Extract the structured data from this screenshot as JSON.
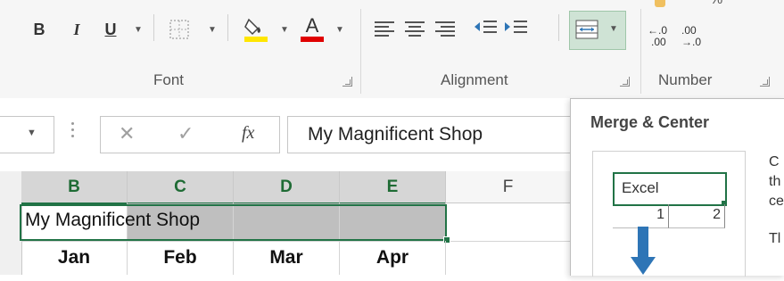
{
  "ribbon": {
    "font_group": {
      "bold": "B",
      "italic": "I",
      "underline": "U",
      "font_color_glyph": "A",
      "label": "Font"
    },
    "alignment_group": {
      "label": "Alignment"
    },
    "number_group": {
      "label": "Number",
      "increase_decimal_top": "←.0",
      "increase_decimal_bottom": ".00",
      "decrease_decimal_top": ".00",
      "decrease_decimal_bottom": "→.0",
      "percent_glyph": "%"
    }
  },
  "formula_bar": {
    "cancel_glyph": "✕",
    "enter_glyph": "✓",
    "fx_label": "fx",
    "content": "My Magnificent Shop"
  },
  "sheet": {
    "columns": [
      "B",
      "C",
      "D",
      "E",
      "F"
    ],
    "title_cell": "My Magnificent Shop",
    "months": [
      "Jan",
      "Feb",
      "Mar",
      "Apr"
    ]
  },
  "tooltip": {
    "title": "Merge & Center",
    "preview_cell": "Excel",
    "preview_values": [
      "1",
      "2"
    ],
    "desc_fragments": [
      "C",
      "th",
      "ce",
      "Tl"
    ]
  },
  "colors": {
    "excel_green": "#217346",
    "ribbon_bg": "#f6f6f6",
    "selection_gray": "#bfbfbf",
    "font_color_red": "#e00000",
    "highlight_yellow": "#ffe600",
    "arrow_blue": "#2e75b6"
  }
}
